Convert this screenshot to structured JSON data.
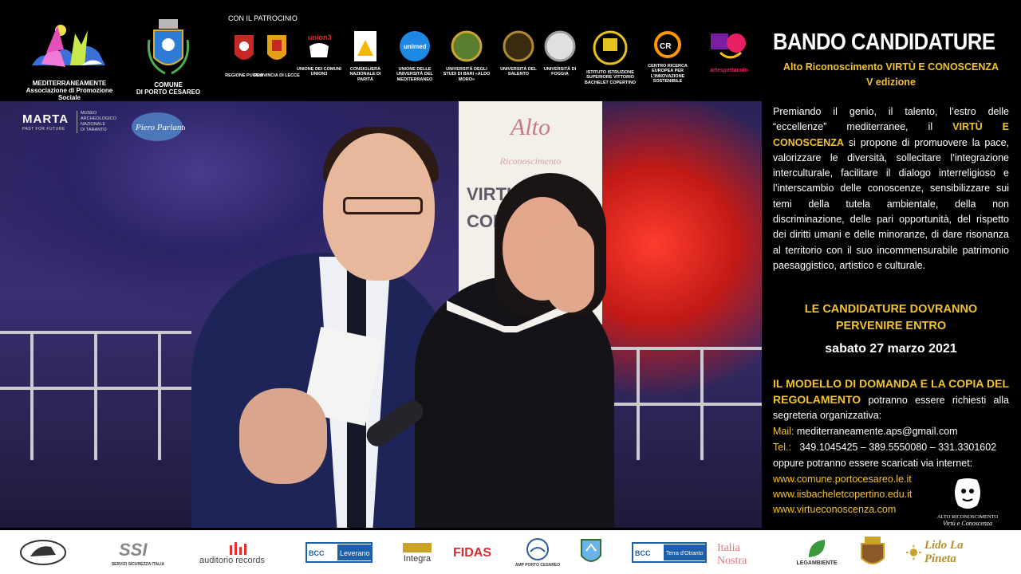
{
  "header": {
    "organizer": {
      "name": "MEDITERRANEAMENTE",
      "subtitle": "Associazione di Promozione Sociale"
    },
    "municipality": {
      "line1": "COMUNE",
      "line2": "DI PORTO CESAREO"
    },
    "patronage_label": "CON IL PATROCINIO",
    "patrons": [
      {
        "label": "REGIONE PUGLIA",
        "icon": "regione-puglia-crest-icon",
        "color": "#c62828"
      },
      {
        "label": "PROVINCIA DI LECCE",
        "icon": "provincia-lecce-crest-icon",
        "color": "#e6a017"
      },
      {
        "label": "UNIONE DEI COMUNI UNION3",
        "icon": "union3-logo-icon",
        "color": "#d32f2f"
      },
      {
        "label": "CONSIGLIERA NAZIONALE DI PARITÀ",
        "icon": "consigliera-parita-sign-icon",
        "color": "#f5b800"
      },
      {
        "label": "UNIONE DELLE UNIVERSITÀ DEL MEDITERRANEO",
        "icon": "unimed-logo-icon",
        "color": "#1e88e5"
      },
      {
        "label": "UNIVERSITÀ DEGLI STUDI DI BARI «ALDO MORO»",
        "icon": "uniba-seal-icon",
        "color": "#c7a535"
      },
      {
        "label": "UNIVERSITÀ DEL SALENTO",
        "icon": "unisalento-seal-icon",
        "color": "#b08a2e"
      },
      {
        "label": "UNIVERSITÀ DI FOGGIA",
        "icon": "unifg-seal-icon",
        "color": "#9e9e9e"
      },
      {
        "label": "ISTITUTO ISTRUZIONE SUPERIORE VITTORIO BACHELET COPERTINO",
        "icon": "bachelet-logo-icon",
        "color": "#e8c21a"
      },
      {
        "label": "CENTRO RICERCA EUROPEA PER L'INNOVAZIONE SOSTENIBILE",
        "icon": "creis-logo-icon",
        "color": "#ff9800"
      },
      {
        "label": "artespettacolo",
        "icon": "artespettacolo-logo-icon",
        "color": "#e91e63"
      }
    ]
  },
  "panel": {
    "title": "BANDO CANDIDATURE",
    "subtitle_line1": "Alto Riconoscimento VIRTÙ E CONOSCENZA",
    "subtitle_line2": "V edizione",
    "intro_before": "Premiando il genio, il talento, l’estro delle “eccellenze” mediterranee, il ",
    "intro_highlight": "VIRTÙ E CONOSCENZA",
    "intro_after": " si propone di promuovere la pace, valorizzare le diversità, sollecitare l’integrazione interculturale, facilitare il dialogo interreligioso e l’interscambio delle conoscenze, sensibilizzare sui temi della tutela ambientale, della non discriminazione, delle pari opportunità, del rispetto dei diritti umani e delle minoranze, di dare risonanza al territorio con il suo incommensurabile patrimonio paesaggistico, artistico e culturale.",
    "deadline_line1": "LE CANDIDATURE DOVRANNO",
    "deadline_line2": "PERVENIRE ENTRO",
    "deadline_date": "sabato 27 marzo 2021",
    "modello_highlight": "IL MODELLO DI DOMANDA E LA COPIA DEL REGOLAMENTO",
    "modello_after": " potranno essere richiesti alla segreteria organizzativa:",
    "mail_label": "Mail:",
    "mail_value": "mediterraneamente.aps@gmail.com",
    "tel_label": "Tel.:",
    "tel_value": "349.1045425 – 389.5550080 – 331.3301602",
    "download_text": "oppure potranno essere scaricati via internet:",
    "links": [
      "www.comune.portocesareo.le.it",
      "www.iisbacheletcopertino.edu.it",
      "www.virtueconoscenza.com"
    ],
    "badge_line1": "ALTO RICONOSCIMENTO",
    "badge_line2": "Virtù e Conoscenza"
  },
  "photo": {
    "banner_word1": "Alto",
    "banner_word2": "Riconoscimento",
    "banner_word3": "VIRTU' E",
    "banner_word4": "CONOS",
    "marta_name": "MARTA",
    "marta_tagline": "PAST FOR FUTURE",
    "marta_desc1": "MUSEO",
    "marta_desc2": "ARCHEOLOGICO",
    "marta_desc3": "NAZIONALE",
    "marta_desc4": "DI TARANTO",
    "piero_logo": "Piero Parlante"
  },
  "sponsors": [
    {
      "label": "FPP",
      "caption": "",
      "icon": "fpp-horse-logo-icon"
    },
    {
      "label": "SSI",
      "caption": "SERVIZI SICUREZZA ITALIA",
      "icon": "ssi-logo-icon"
    },
    {
      "label": "auditorio records",
      "caption": "",
      "icon": "auditorio-records-logo-icon"
    },
    {
      "label": "BCC Leverano",
      "caption": "",
      "icon": "bcc-leverano-logo-icon"
    },
    {
      "label": "Integra",
      "caption": "",
      "icon": "integra-logo-icon"
    },
    {
      "label": "FIDAS",
      "caption": "",
      "icon": "fidas-logo-icon"
    },
    {
      "label": "AMP PORTO CESAREO",
      "caption": "AMP PORTO CESAREO",
      "icon": "amp-porto-cesareo-logo-icon"
    },
    {
      "label": "",
      "caption": "",
      "icon": "bird-crest-logo-icon"
    },
    {
      "label": "BCC Terra d'Otranto",
      "caption": "",
      "icon": "bcc-terra-otranto-logo-icon"
    },
    {
      "label": "Italia Nostra",
      "caption": "",
      "icon": "italia-nostra-logo-icon"
    },
    {
      "label": "LEGAMBIENTE",
      "caption": "LEGAMBIENTE",
      "icon": "legambiente-logo-icon"
    },
    {
      "label": "",
      "caption": "",
      "icon": "coat-of-arms-logo-icon"
    },
    {
      "label": "Lido La Pineta",
      "caption": "",
      "icon": "lido-la-pineta-logo-icon"
    }
  ]
}
